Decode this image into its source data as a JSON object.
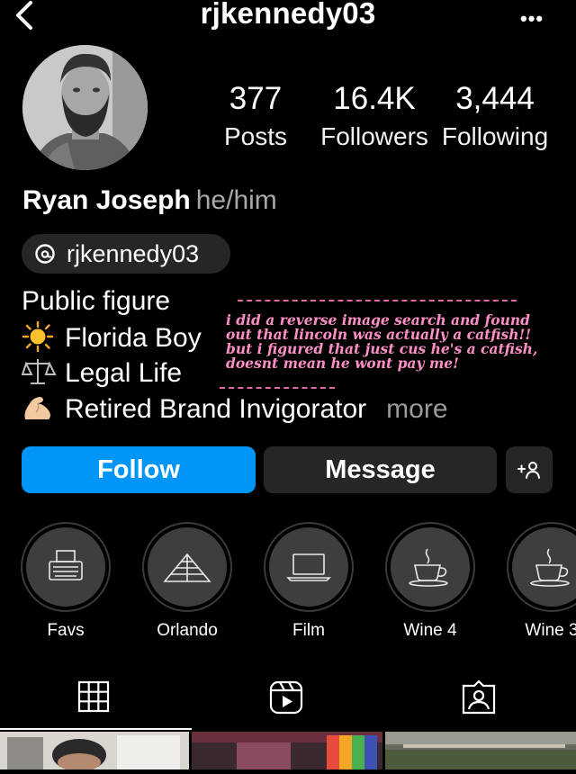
{
  "header": {
    "username": "rjkennedy03",
    "back_icon": "chevron-left-icon",
    "menu_icon": "more-horizontal-icon",
    "menu_glyph": "•••"
  },
  "profile": {
    "stats": [
      {
        "value": "377",
        "label": "Posts"
      },
      {
        "value": "16.4K",
        "label": "Followers"
      },
      {
        "value": "3,444",
        "label": "Following"
      }
    ],
    "name": "Ryan Joseph",
    "pronouns": "he/him",
    "threads_handle": "rjkennedy03",
    "bio": {
      "line1": "Public figure",
      "line2": "Florida Boy",
      "line3": "Legal Life",
      "line4": "Retired Brand Invigorator",
      "more": "more"
    }
  },
  "annotation": {
    "text": "i did a reverse image search and found out that lincoln was actually a catfish!! but i figured that just cus he's a catfish, doesnt mean he wont pay me!",
    "color": "#ff8ec8"
  },
  "actions": {
    "follow": "Follow",
    "message": "Message",
    "add_person_icon": "add-person-icon"
  },
  "highlights": [
    {
      "label": "Favs",
      "icon": "typewriter-icon"
    },
    {
      "label": "Orlando",
      "icon": "pyramid-icon"
    },
    {
      "label": "Film",
      "icon": "laptop-icon"
    },
    {
      "label": "Wine 4",
      "icon": "coffee-cup-icon"
    },
    {
      "label": "Wine 3",
      "icon": "coffee-cup-icon"
    }
  ],
  "tabs": [
    {
      "icon": "grid-icon",
      "active": true
    },
    {
      "icon": "reels-icon",
      "active": false
    },
    {
      "icon": "tagged-icon",
      "active": false
    }
  ],
  "colors": {
    "accent": "#0095f6",
    "button_dark": "#262626",
    "muted": "#a8a8a8"
  }
}
